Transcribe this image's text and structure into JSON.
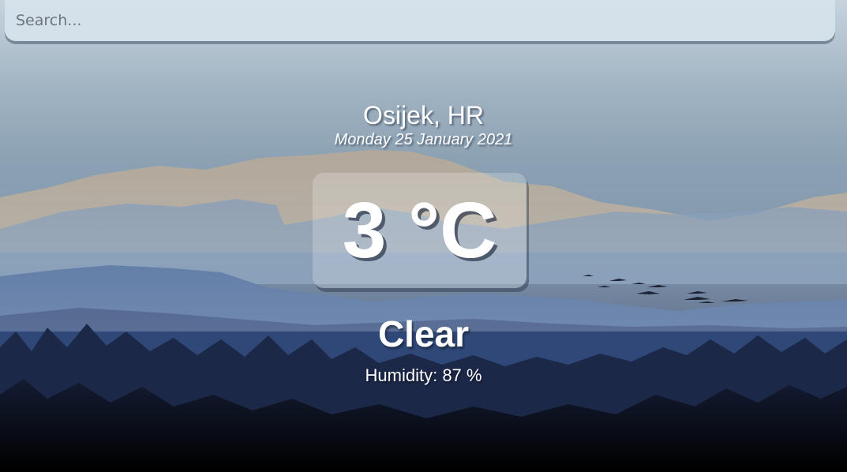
{
  "search": {
    "placeholder": "Search...",
    "value": ""
  },
  "weather": {
    "location": "Osijek, HR",
    "date": "Monday 25 January 2021",
    "temperature": "3 °C",
    "condition": "Clear",
    "humidity": "Humidity: 87 %"
  },
  "background": {
    "scene": "mountain-forest-landscape",
    "colors": {
      "sky_top": "#c6d3dd",
      "mountains_far": "#b7a89a",
      "mountains_mid": "#4a6a98",
      "forest": "#1e2d50",
      "ground": "#05070d"
    }
  }
}
